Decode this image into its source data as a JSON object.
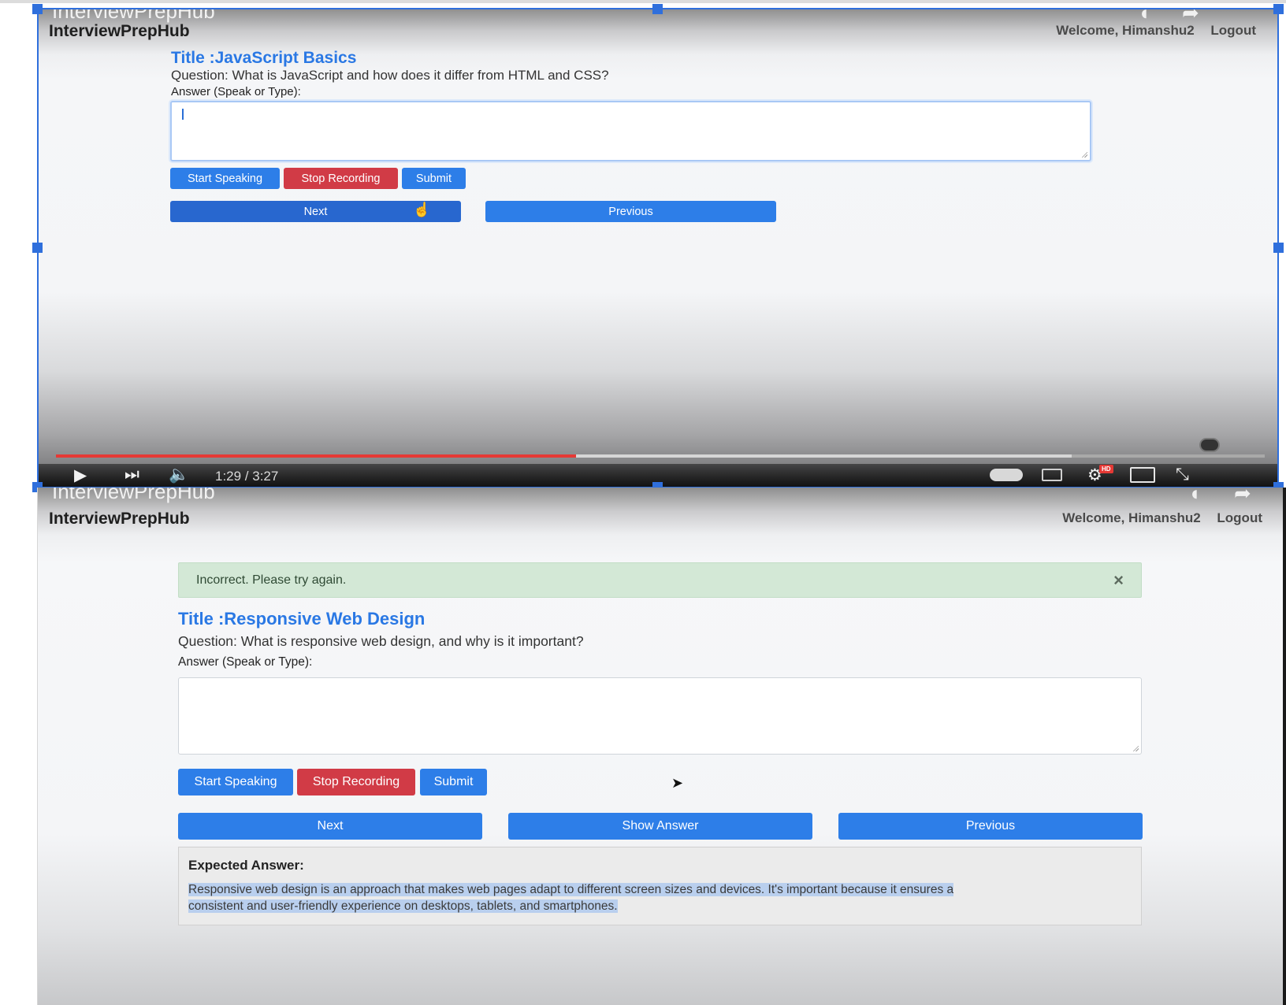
{
  "top_frame": {
    "ghost_title": "InterviewPrepHub",
    "brand": "InterviewPrepHub",
    "welcome": "Welcome, Himanshu2",
    "logout": "Logout",
    "question_title": "Title :JavaScript Basics",
    "question_text": "Question: What is JavaScript and how does it differ from HTML and CSS?",
    "answer_label": "Answer (Speak or Type):",
    "answer_value": "",
    "buttons": {
      "start_speaking": "Start Speaking",
      "stop_recording": "Stop Recording",
      "submit": "Submit",
      "next": "Next",
      "previous": "Previous"
    },
    "video": {
      "time": "1:29 / 3:27",
      "progress_fraction": 0.43,
      "quality_badge": "HD"
    }
  },
  "bottom_frame": {
    "ghost_title": "InterviewPrepHub",
    "brand": "InterviewPrepHub",
    "welcome": "Welcome, Himanshu2",
    "logout": "Logout",
    "alert_text": "Incorrect. Please try again.",
    "alert_close": "×",
    "question_title": "Title :Responsive Web Design",
    "question_text": "Question: What is responsive web design, and why is it important?",
    "answer_label": "Answer (Speak or Type):",
    "answer_value": "",
    "buttons": {
      "start_speaking": "Start Speaking",
      "stop_recording": "Stop Recording",
      "submit": "Submit",
      "next": "Next",
      "show_answer": "Show Answer",
      "previous": "Previous"
    },
    "expected_answer_label": "Expected Answer:",
    "expected_answer_line1": "Responsive web design is an approach that makes web pages adapt to different screen sizes and devices. It's important because it ensures a",
    "expected_answer_line2": "consistent and user-friendly experience on desktops, tablets, and smartphones."
  },
  "colors": {
    "primary": "#2d7ee8",
    "danger": "#d13b46",
    "title": "#2a78e4",
    "alert_bg": "#d3e8d6",
    "selection": "#2f6fdc",
    "progress": "#e53935"
  },
  "icons": [
    "play-icon",
    "skip-next-icon",
    "volume-icon",
    "autoplay-toggle-icon",
    "subtitles-icon",
    "settings-gear-icon",
    "airplay-icon",
    "exit-fullscreen-icon",
    "close-icon",
    "hand-pointer-cursor-icon",
    "arrow-cursor-icon",
    "share-arrow-icon",
    "watch-later-icon"
  ]
}
